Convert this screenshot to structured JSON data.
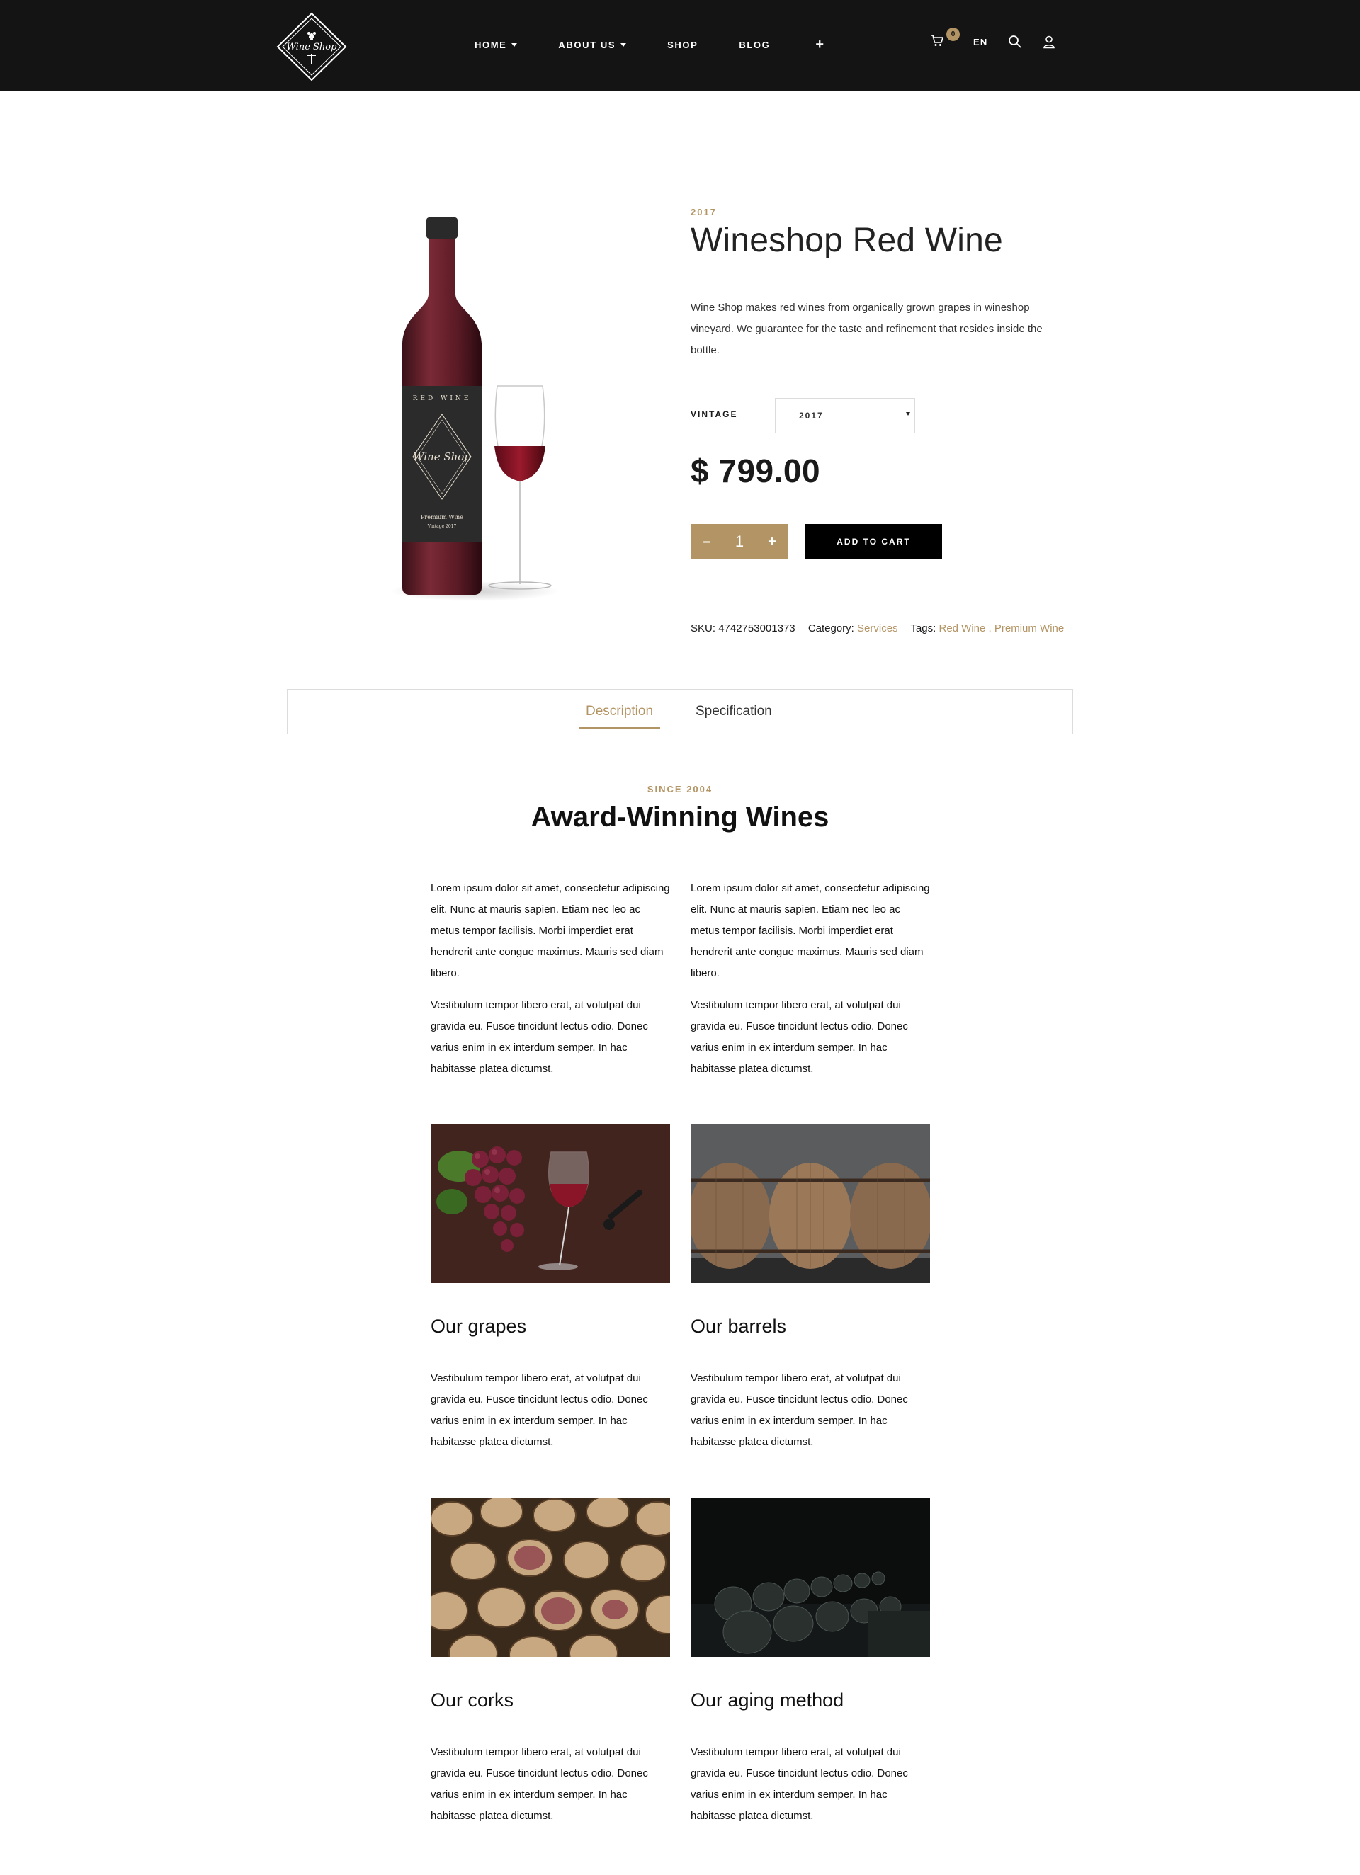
{
  "header": {
    "logo_text": "Wine Shop",
    "nav": [
      {
        "label": "HOME"
      },
      {
        "label": "ABOUT US"
      },
      {
        "label": "SHOP"
      },
      {
        "label": "BLOG"
      }
    ],
    "plus": "+",
    "cart_count": "0",
    "language": "EN"
  },
  "product": {
    "year": "2017",
    "title": "Wineshop Red Wine",
    "description": "Wine Shop makes red wines from organically grown grapes in wineshop vineyard. We guarantee for the taste and refinement that resides inside the bottle.",
    "vintage_label": "VINTAGE",
    "vintage_value": "2017",
    "price": "$ 799.00",
    "qty_minus": "–",
    "qty_value": "1",
    "qty_plus": "+",
    "add_to_cart": "ADD TO CART",
    "sku_label": "SKU:",
    "sku": "4742753001373",
    "category_label": "Category:",
    "category": "Services",
    "tags_label": "Tags:",
    "tags": "Red Wine , Premium Wine",
    "bottle_label_top": "RED WINE",
    "bottle_logo": "Wine Shop",
    "bottle_label_bottom": "Premium Wine",
    "bottle_label_vintage": "Vintage 2017"
  },
  "tabs": [
    {
      "label": "Description"
    },
    {
      "label": "Specification"
    }
  ],
  "section": {
    "eyebrow": "SINCE 2004",
    "title": "Award-Winning Wines",
    "intro_left": [
      "Lorem ipsum dolor sit amet, consectetur adipiscing elit. Nunc at mauris sapien. Etiam nec leo ac metus tempor facilisis. Morbi imperdiet erat hendrerit ante congue maximus. Mauris sed diam libero.",
      "Vestibulum tempor libero erat, at volutpat dui gravida eu. Fusce tincidunt lectus odio. Donec varius enim in ex interdum semper. In hac habitasse platea dictumst."
    ],
    "intro_right": [
      "Lorem ipsum dolor sit amet, consectetur adipiscing elit. Nunc at mauris sapien. Etiam nec leo ac metus tempor facilisis. Morbi imperdiet erat hendrerit ante congue maximus. Mauris sed diam libero.",
      "Vestibulum tempor libero erat, at volutpat dui gravida eu. Fusce tincidunt lectus odio. Donec varius enim in ex interdum semper. In hac habitasse platea dictumst."
    ],
    "features": [
      {
        "title": "Our grapes",
        "text": "Vestibulum tempor libero erat, at volutpat dui gravida eu. Fusce tincidunt lectus odio. Donec varius enim in ex interdum semper. In hac habitasse platea dictumst."
      },
      {
        "title": "Our barrels",
        "text": "Vestibulum tempor libero erat, at volutpat dui gravida eu. Fusce tincidunt lectus odio. Donec varius enim in ex interdum semper. In hac habitasse platea dictumst."
      },
      {
        "title": "Our corks",
        "text": "Vestibulum tempor libero erat, at volutpat dui gravida eu. Fusce tincidunt lectus odio. Donec varius enim in ex interdum semper. In hac habitasse platea dictumst."
      },
      {
        "title": "Our aging method",
        "text": "Vestibulum tempor libero erat, at volutpat dui gravida eu. Fusce tincidunt lectus odio. Donec varius enim in ex interdum semper. In hac habitasse platea dictumst."
      }
    ]
  },
  "colors": {
    "accent": "#b39464",
    "header_bg": "#141414",
    "button_dark": "#000000"
  },
  "icons": [
    "cart-icon",
    "search-icon",
    "user-icon",
    "logo-diamond-icon"
  ]
}
